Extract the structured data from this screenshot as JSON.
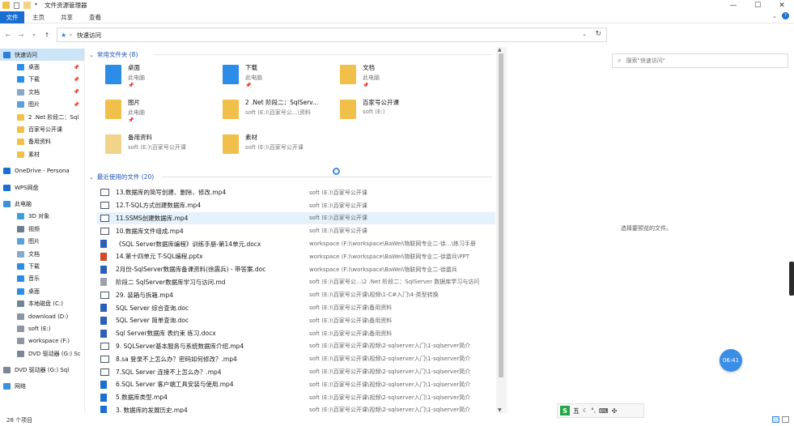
{
  "window": {
    "title": "文件资源管理器",
    "minimize_label": "—",
    "maximize_label": "☐",
    "close_label": "✕"
  },
  "ribbon": {
    "tabs": [
      "文件",
      "主页",
      "共享",
      "查看"
    ]
  },
  "address": {
    "path": "快速访问",
    "search_placeholder": "搜索\"快速访问\""
  },
  "nav": {
    "items": [
      {
        "label": "快速访问",
        "icon": "star-icon",
        "color": "#2f7be0",
        "pinned": false,
        "selected": true
      },
      {
        "label": "桌面",
        "icon": "desktop-icon",
        "color": "#2b8de8",
        "pinned": true
      },
      {
        "label": "下载",
        "icon": "download-icon",
        "color": "#2b8de8",
        "pinned": true
      },
      {
        "label": "文档",
        "icon": "documents-icon",
        "color": "#8aa8c8",
        "pinned": true
      },
      {
        "label": "图片",
        "icon": "pictures-icon",
        "color": "#5aa0dc",
        "pinned": true
      },
      {
        "label": "2 .Net 阶段二：Sql",
        "icon": "folder-icon",
        "color": "#f1c04a"
      },
      {
        "label": "百家号公开课",
        "icon": "folder-icon",
        "color": "#f1c04a"
      },
      {
        "label": "备用资料",
        "icon": "folder-icon",
        "color": "#f1c04a"
      },
      {
        "label": "素材",
        "icon": "folder-icon",
        "color": "#f1c04a"
      },
      {
        "label": "",
        "gap": true
      },
      {
        "label": "OneDrive - Persona",
        "icon": "cloud-icon",
        "color": "#1c6fd2"
      },
      {
        "label": "",
        "gap": true
      },
      {
        "label": "WPS网盘",
        "icon": "wps-cloud-icon",
        "color": "#1c6fd2"
      },
      {
        "label": "",
        "gap": true
      },
      {
        "label": "此电脑",
        "icon": "computer-icon",
        "color": "#3d8fe0"
      },
      {
        "label": "3D 对象",
        "icon": "3d-objects-icon",
        "color": "#3aa0e0"
      },
      {
        "label": "视频",
        "icon": "video-icon",
        "color": "#6b7c8e"
      },
      {
        "label": "图片",
        "icon": "pictures-icon",
        "color": "#5aa0dc"
      },
      {
        "label": "文档",
        "icon": "documents-icon",
        "color": "#8aa8c8"
      },
      {
        "label": "下载",
        "icon": "download-icon",
        "color": "#2b8de8"
      },
      {
        "label": "音乐",
        "icon": "music-icon",
        "color": "#2b8de8"
      },
      {
        "label": "桌面",
        "icon": "desktop-icon",
        "color": "#2b8de8"
      },
      {
        "label": "本地磁盘 (C:)",
        "icon": "drive-icon",
        "color": "#6f8596"
      },
      {
        "label": "download (D:)",
        "icon": "drive-icon",
        "color": "#8c97a3"
      },
      {
        "label": "soft (E:)",
        "icon": "drive-icon",
        "color": "#8c97a3"
      },
      {
        "label": "workspace (F:)",
        "icon": "drive-icon",
        "color": "#8c97a3"
      },
      {
        "label": "DVD 驱动器 (G:) Sc",
        "icon": "dvd-icon",
        "color": "#7b8794"
      },
      {
        "label": "",
        "gap": true
      },
      {
        "label": "DVD 驱动器 (G:) Sql",
        "icon": "dvd-icon",
        "color": "#7b8794"
      },
      {
        "label": "",
        "gap": true
      },
      {
        "label": "网络",
        "icon": "network-icon",
        "color": "#3d8fe0"
      }
    ]
  },
  "frequent": {
    "header": "常用文件夹 (8)",
    "tiles": [
      {
        "name": "桌面",
        "sub": "此电脑",
        "pinned": true,
        "icon": "desktop-folder-icon",
        "color": "#2b8de8"
      },
      {
        "name": "下载",
        "sub": "此电脑",
        "pinned": true,
        "icon": "download-folder-icon",
        "color": "#2b8de8"
      },
      {
        "name": "文档",
        "sub": "此电脑",
        "pinned": true,
        "icon": "documents-folder-icon",
        "color": "#f1c04a"
      },
      {
        "name": "图片",
        "sub": "此电脑",
        "pinned": true,
        "icon": "pictures-folder-icon",
        "color": "#f1c04a"
      },
      {
        "name": "2 .Net 阶段二：SqlServ...",
        "sub": "soft (E:)\\百家号公...\\资料",
        "pinned": false,
        "icon": "folder-icon",
        "color": "#f1c04a"
      },
      {
        "name": "百家号公开课",
        "sub": "soft (E:)",
        "pinned": false,
        "icon": "folder-icon",
        "color": "#f1c04a"
      },
      {
        "name": "备用资料",
        "sub": "soft (E:)\\百家号公开课",
        "pinned": false,
        "icon": "folder-icon",
        "color": "#f1d48a"
      },
      {
        "name": "素材",
        "sub": "soft (E:)\\百家号公开课",
        "pinned": false,
        "icon": "folder-icon",
        "color": "#f1c04a"
      }
    ]
  },
  "recent": {
    "header": "最近使用的文件 (20)",
    "files": [
      {
        "name": "13.数据库的简写创建、删除、修改.mp4",
        "loc": "soft (E:)\\百家号公开课",
        "icon": "video-file-icon"
      },
      {
        "name": "12.T-SQL方式创建数据库.mp4",
        "loc": "soft (E:)\\百家号公开课",
        "icon": "video-file-icon"
      },
      {
        "name": "11.SSMS创建数据库.mp4",
        "loc": "soft (E:)\\百家号公开课",
        "icon": "video-file-icon",
        "highlight": true
      },
      {
        "name": "10.数据库文件组成.mp4",
        "loc": "soft (E:)\\百家号公开课",
        "icon": "video-file-icon"
      },
      {
        "name": "《SQL Server数据库编程》训练手册-第14单元.docx",
        "loc": "workspace (F:)\\workspace\\BaWei\\物联网专业二-徐...\\练习手册",
        "icon": "word-file-icon"
      },
      {
        "name": "14.第十四单元 T-SQL编程.pptx",
        "loc": "workspace (F:)\\workspace\\BaWei\\物联网专业二-徐震兵\\PPT",
        "icon": "ppt-file-icon"
      },
      {
        "name": "2月份-SqlServer数据库备课资料(徐震兵) - 带答案.doc",
        "loc": "workspace (F:)\\workspace\\BaWei\\物联网专业二-徐震兵",
        "icon": "word-file-icon"
      },
      {
        "name": "阶段二 SqlServer数据库学习与访问.md",
        "loc": "soft (E:)\\百家号公...\\2 .Net 阶段二：SqlServer 数据库学习与访问",
        "icon": "md-file-icon"
      },
      {
        "name": "29. 装箱与拆箱.mp4",
        "loc": "soft (E:)\\百家号公开课\\视频\\1-C#入门\\4-类型转换",
        "icon": "video-file-icon"
      },
      {
        "name": "SQL Server 综合查询.doc",
        "loc": "soft (E:)\\百家号公开课\\备用资料",
        "icon": "word-file-icon"
      },
      {
        "name": "SQL Server 简单查询.doc",
        "loc": "soft (E:)\\百家号公开课\\备用资料",
        "icon": "word-file-icon"
      },
      {
        "name": "Sql Server数据库 表约束 练习.docx",
        "loc": "soft (E:)\\百家号公开课\\备用资料",
        "icon": "word-file-icon"
      },
      {
        "name": "9. SQLServer基本服务与系统数据库介绍.mp4",
        "loc": "soft (E:)\\百家号公开课\\视频\\2-sqlserver入门\\1-sqlserver简介",
        "icon": "video-file-icon"
      },
      {
        "name": "8.sa 登录不上怎么办？密码如何修改？.mp4",
        "loc": "soft (E:)\\百家号公开课\\视频\\2-sqlserver入门\\1-sqlserver简介",
        "icon": "video-file-icon"
      },
      {
        "name": "7.SQL Server 连接不上怎么办？.mp4",
        "loc": "soft (E:)\\百家号公开课\\视频\\2-sqlserver入门\\1-sqlserver简介",
        "icon": "video-file-icon"
      },
      {
        "name": "6.SQL Server 客户端工具安装与使用.mp4",
        "loc": "soft (E:)\\百家号公开课\\视频\\2-sqlserver入门\\1-sqlserver简介",
        "icon": "video-play-file-icon"
      },
      {
        "name": "5.数据库类型.mp4",
        "loc": "soft (E:)\\百家号公开课\\视频\\2-sqlserver入门\\1-sqlserver简介",
        "icon": "video-play-file-icon"
      },
      {
        "name": "3. 数据库的发展历史.mp4",
        "loc": "soft (E:)\\百家号公开课\\视频\\2-sqlserver入门\\1-sqlserver简介",
        "icon": "video-play-file-icon"
      }
    ]
  },
  "preview": {
    "message": "选择要预览的文件。"
  },
  "overlay": {
    "clock": "06:41",
    "ime_label": "五"
  },
  "status": {
    "count": "28 个项目"
  },
  "colors": {
    "accent": "#1a6dd1",
    "selection": "#cce4f7",
    "hover": "#e5f1fb",
    "link": "#1c4fb8"
  }
}
